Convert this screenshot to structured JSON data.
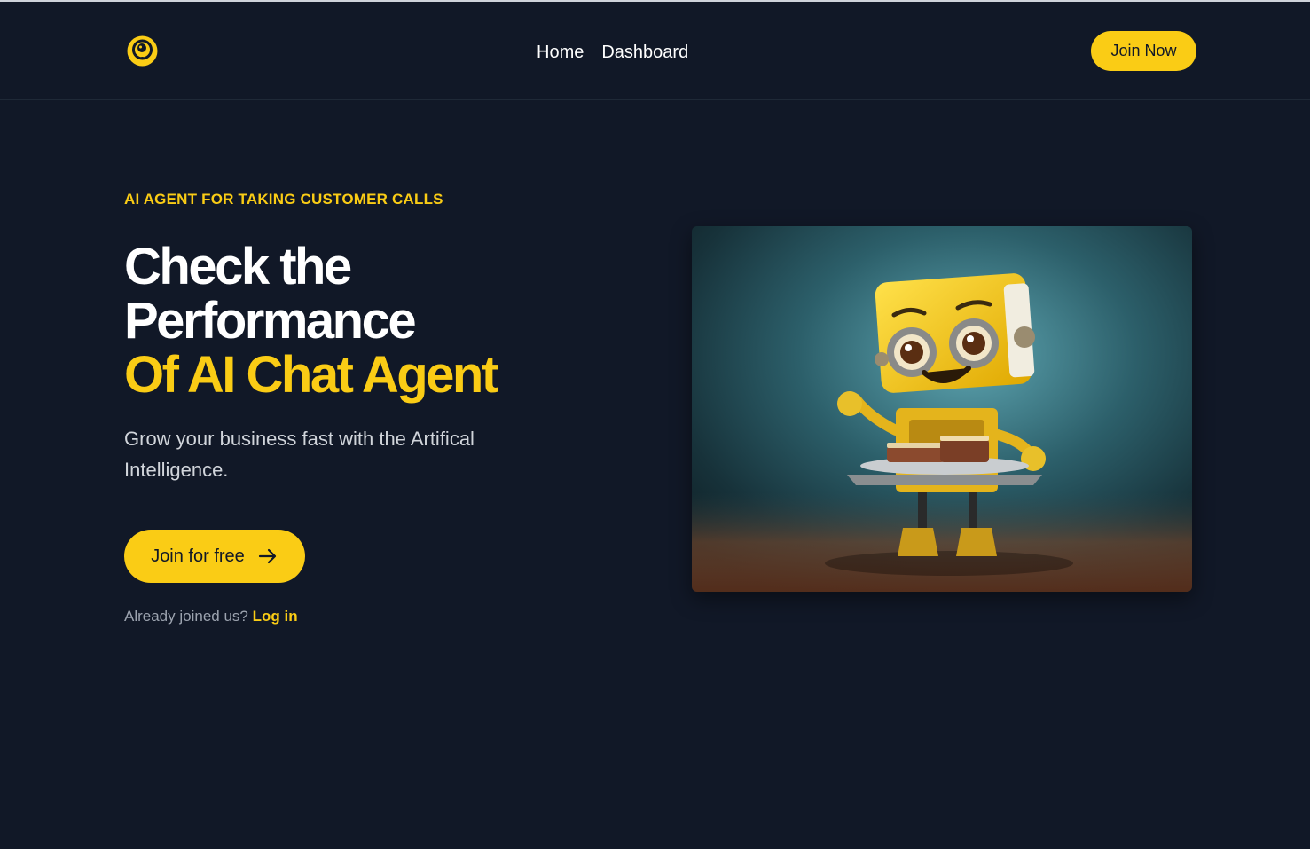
{
  "nav": {
    "logo_icon": "robot-head-logo-icon",
    "links": [
      "Home",
      "Dashboard"
    ],
    "join_label": "Join Now"
  },
  "hero": {
    "eyebrow": "AI AGENT FOR TAKING CUSTOMER CALLS",
    "title_line1": "Check the",
    "title_line2": "Performance",
    "title_line3": "Of AI Chat Agent",
    "subtitle": "Grow your business fast with the Artifical Intelligence.",
    "cta_label": "Join for free",
    "cta_icon": "arrow-right-icon",
    "login_prompt": "Already joined us?",
    "login_link": "Log in",
    "image_subject": "yellow robot holding tray of sandwiches"
  },
  "colors": {
    "background": "#111827",
    "accent": "#facc15",
    "muted_text": "#9ca3af"
  }
}
